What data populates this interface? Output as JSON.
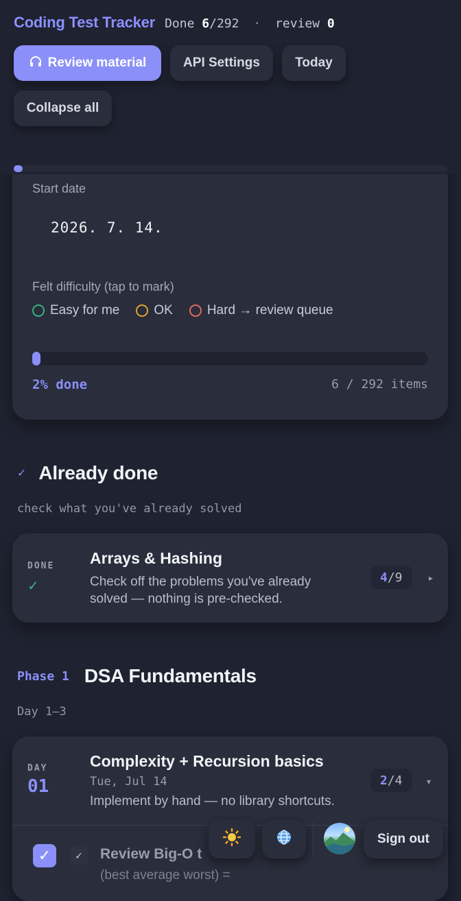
{
  "header": {
    "title": "Coding Test Tracker",
    "done_label": "Done",
    "done_count": "6",
    "done_total": "/292",
    "separator": "·",
    "review_label": "review",
    "review_count": "0",
    "buttons": {
      "review_material": "Review material",
      "review_icon": "headphones-icon",
      "api_settings": "API Settings",
      "today": "Today",
      "collapse_all": "Collapse all"
    },
    "progress_fraction": 0.02
  },
  "settings": {
    "start_date_label": "Start date",
    "start_date_value": "2026. 7. 14.",
    "difficulty_label": "Felt difficulty (tap to mark)",
    "difficulty_options": [
      {
        "label": "Easy for me",
        "color": "#37b37e"
      },
      {
        "label": "OK",
        "color": "#e0a330"
      },
      {
        "label": "Hard → review queue",
        "color": "#e26a5e"
      }
    ],
    "progress_fraction": 0.02,
    "progress_pct": "2% done",
    "progress_count": "6 / 292 items"
  },
  "already_done": {
    "check_icon": "check-icon",
    "title": "Already done",
    "subtitle": "check what you've already solved",
    "card": {
      "tag": "DONE",
      "check_icon": "check-icon",
      "title": "Arrays & Hashing",
      "desc": "Check off the problems you've already solved — nothing is pre-checked.",
      "done": "4",
      "total": "/9",
      "caret": "▸"
    }
  },
  "phase1": {
    "phase_label": "Phase 1",
    "title": "DSA Fundamentals",
    "subtitle": "Day 1–3",
    "day_card": {
      "tag": "DAY",
      "day": "01",
      "title": "Complexity + Recursion basics",
      "date": "Tue, Jul 14",
      "desc": "Implement by hand — no library shortcuts.",
      "done": "2",
      "total": "/4",
      "caret": "▾"
    },
    "task": {
      "title": "Review Big-O t",
      "sub": "(best average worst) ="
    }
  },
  "footer": {
    "theme_icon": "sun-icon",
    "language_icon": "globe-icon",
    "avatar": "avatar",
    "sign_out": "Sign out"
  },
  "colors": {
    "accent": "#8b8ff8",
    "background": "#1f2230",
    "card": "#2a2d3b",
    "done_green": "#37b37e"
  }
}
